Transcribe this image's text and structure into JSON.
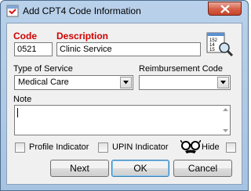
{
  "window": {
    "title": "Add CPT4 Code Information",
    "close_icon": "close-x-icon"
  },
  "form": {
    "code_label": "Code",
    "code_value": "0521",
    "description_label": "Description",
    "description_value": "Clinic Service",
    "lookup_icon": "code-lookup-icon",
    "lookup_icon_numbers": [
      "152",
      "14",
      "15"
    ],
    "type_of_service_label": "Type of Service",
    "type_of_service_value": "Medical Care",
    "reimbursement_code_label": "Reimbursement Code",
    "reimbursement_code_value": "",
    "note_label": "Note",
    "note_value": "",
    "profile_indicator_label": "Profile Indicator",
    "profile_indicator_checked": false,
    "upin_indicator_label": "UPIN Indicator",
    "upin_indicator_checked": false,
    "hide_label": "Hide",
    "hide_icon": "disguise-glasses-icon",
    "hide_checked": false
  },
  "buttons": {
    "next": "Next",
    "ok": "OK",
    "cancel": "Cancel"
  },
  "colors": {
    "required_label": "#d00000",
    "title_bar": "#b9d1ea",
    "close_button": "#c8452b"
  }
}
